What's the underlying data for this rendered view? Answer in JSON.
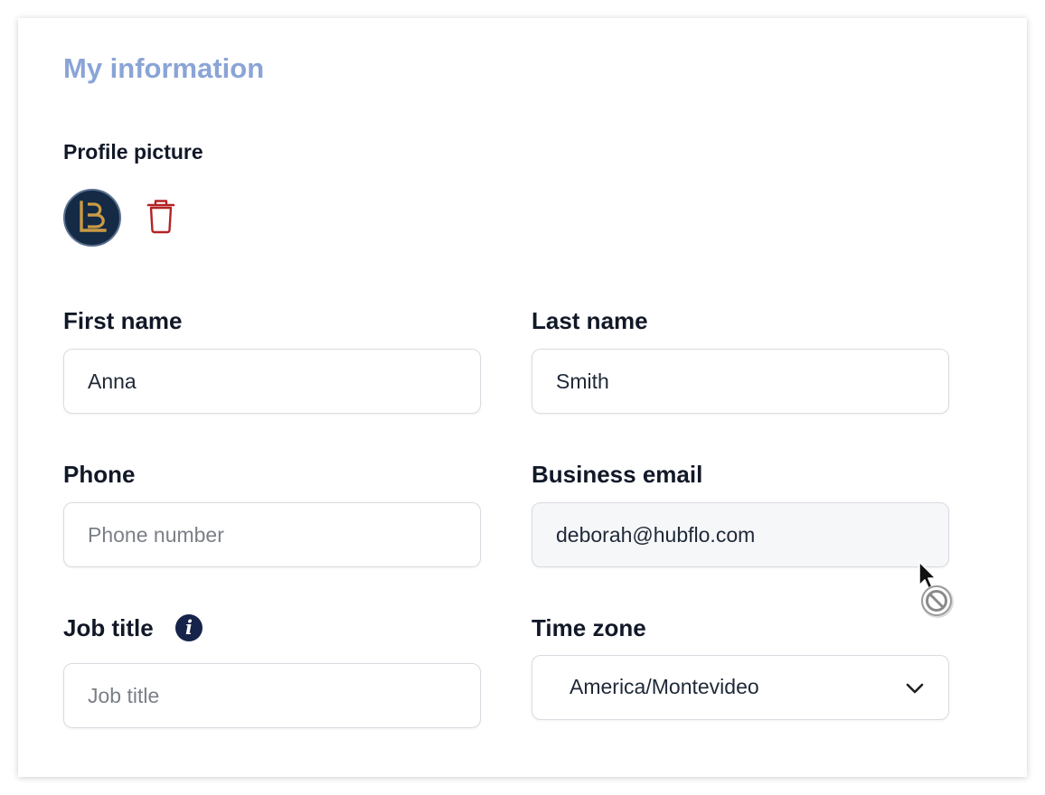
{
  "section": {
    "title": "My information"
  },
  "profile_picture": {
    "label": "Profile picture",
    "avatar_letter": "B"
  },
  "fields": {
    "first_name": {
      "label": "First name",
      "value": "Anna",
      "placeholder": ""
    },
    "last_name": {
      "label": "Last name",
      "value": "Smith",
      "placeholder": ""
    },
    "phone": {
      "label": "Phone",
      "value": "",
      "placeholder": "Phone number"
    },
    "business_email": {
      "label": "Business email",
      "value": "deborah@hubflo.com",
      "placeholder": ""
    },
    "job_title": {
      "label": "Job title",
      "value": "",
      "placeholder": "Job title",
      "info_icon": "info-icon"
    },
    "time_zone": {
      "label": "Time zone",
      "value": "America/Montevideo"
    }
  },
  "colors": {
    "title": "#8aa4d6",
    "delete": "#b42323",
    "avatar_bg": "#142a45",
    "avatar_logo": "#c99b45",
    "info_icon": "#16234a"
  },
  "icons": {
    "delete": "trash-icon",
    "dropdown": "chevron-down-icon",
    "cursor": "not-allowed-cursor-icon"
  }
}
